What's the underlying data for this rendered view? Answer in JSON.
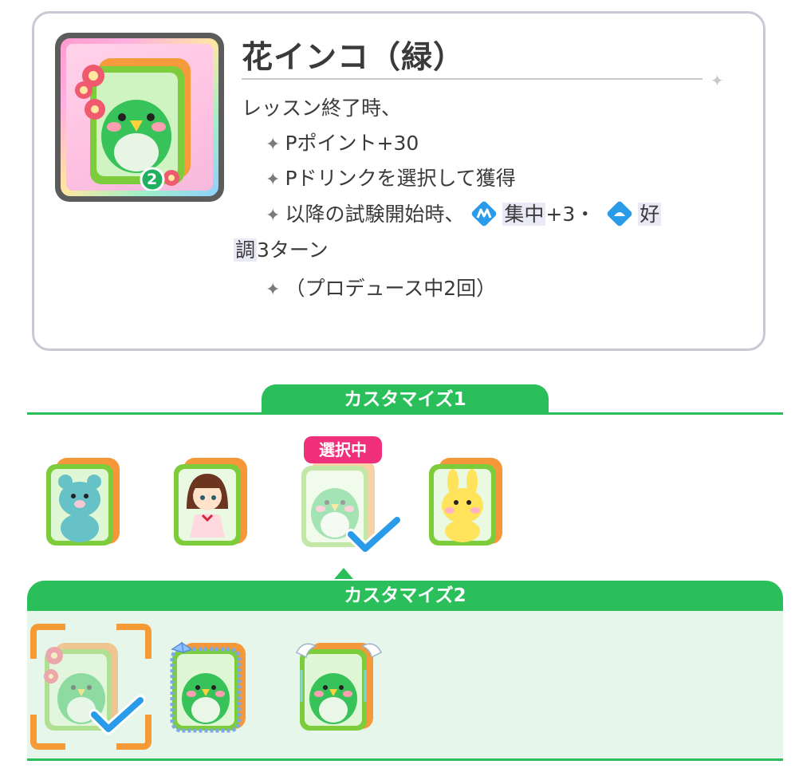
{
  "item": {
    "title": "花インコ（緑）",
    "badge_number": "2",
    "description": {
      "line1": "レッスン終了時、",
      "bullet1": "Pポイント+30",
      "bullet2": "Pドリンクを選択して獲得",
      "bullet3_prefix": "以降の試験開始時、",
      "focus_label": "集中",
      "focus_value": "+3・",
      "good_label_a": "好",
      "good_label_b": "調",
      "good_suffix": "3ターン",
      "bullet4": "（プロデュース中2回）"
    }
  },
  "customize1": {
    "header": "カスタマイズ1",
    "selected_badge": "選択中",
    "options": [
      {
        "name": "teal-bear",
        "selected": false
      },
      {
        "name": "doll-girl",
        "selected": false
      },
      {
        "name": "green-parakeet",
        "selected": true
      },
      {
        "name": "yellow-rabbit",
        "selected": false
      }
    ]
  },
  "customize2": {
    "header": "カスタマイズ2",
    "options": [
      {
        "name": "flower-decoration",
        "selected": true
      },
      {
        "name": "ribbon-frame",
        "selected": false
      },
      {
        "name": "angel-wings",
        "selected": false
      }
    ]
  },
  "colors": {
    "accent_green": "#2bbf5b",
    "selected_pink": "#f0307a",
    "focus_orange": "#f59a34",
    "check_blue": "#2a9be8"
  },
  "icons": [
    "sparkle-icon",
    "focus-status-icon",
    "good-condition-status-icon",
    "checkmark-icon"
  ]
}
